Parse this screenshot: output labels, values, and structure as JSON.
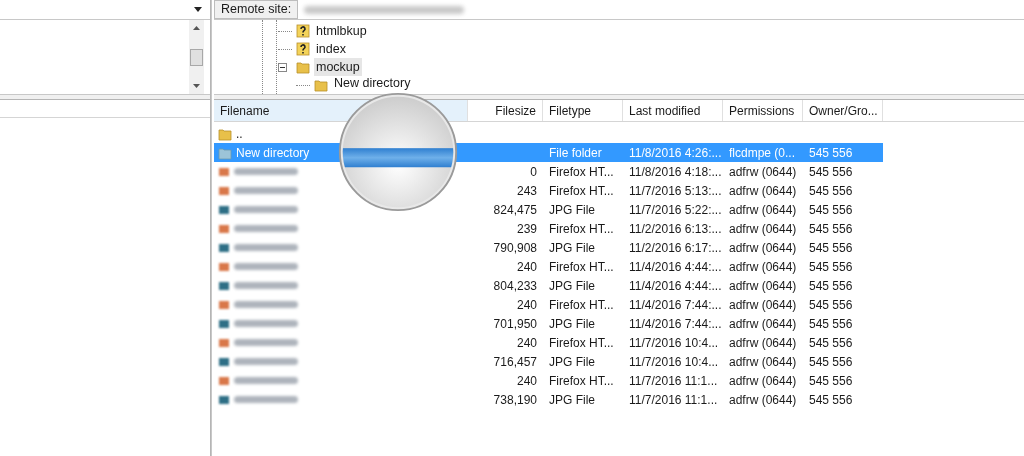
{
  "remote_site": {
    "label": "Remote site:"
  },
  "tree": [
    {
      "label": "htmlbkup",
      "kind": "unknown",
      "selected": false
    },
    {
      "label": "index",
      "kind": "unknown",
      "selected": false
    },
    {
      "label": "mockup",
      "kind": "folder",
      "selected": true,
      "expanded": true,
      "children": [
        {
          "label": "New directory",
          "kind": "folder",
          "selected": false
        }
      ]
    }
  ],
  "file_list": {
    "columns": [
      "Filename",
      "Filesize",
      "Filetype",
      "Last modified",
      "Permissions",
      "Owner/Gro..."
    ],
    "rows": [
      {
        "kind": "parent",
        "name": "..",
        "selected": false
      },
      {
        "kind": "folder",
        "name": "New directory",
        "filesize": "",
        "filetype": "File folder",
        "modified": "11/8/2016 4:26:...",
        "permissions": "flcdmpe (0...",
        "owner": "545 556",
        "selected": true
      },
      {
        "kind": "html",
        "filesize": "0",
        "filetype": "Firefox HT...",
        "modified": "11/8/2016 4:18:...",
        "permissions": "adfrw (0644)",
        "owner": "545 556",
        "selected": false
      },
      {
        "kind": "html",
        "filesize": "243",
        "filetype": "Firefox HT...",
        "modified": "11/7/2016 5:13:...",
        "permissions": "adfrw (0644)",
        "owner": "545 556",
        "selected": false
      },
      {
        "kind": "jpg",
        "filesize": "824,475",
        "filetype": "JPG File",
        "modified": "11/7/2016 5:22:...",
        "permissions": "adfrw (0644)",
        "owner": "545 556",
        "selected": false
      },
      {
        "kind": "html",
        "filesize": "239",
        "filetype": "Firefox HT...",
        "modified": "11/2/2016 6:13:...",
        "permissions": "adfrw (0644)",
        "owner": "545 556",
        "selected": false
      },
      {
        "kind": "jpg",
        "filesize": "790,908",
        "filetype": "JPG File",
        "modified": "11/2/2016 6:17:...",
        "permissions": "adfrw (0644)",
        "owner": "545 556",
        "selected": false
      },
      {
        "kind": "html",
        "filesize": "240",
        "filetype": "Firefox HT...",
        "modified": "11/4/2016 4:44:...",
        "permissions": "adfrw (0644)",
        "owner": "545 556",
        "selected": false
      },
      {
        "kind": "jpg",
        "filesize": "804,233",
        "filetype": "JPG File",
        "modified": "11/4/2016 4:44:...",
        "permissions": "adfrw (0644)",
        "owner": "545 556",
        "selected": false
      },
      {
        "kind": "html",
        "filesize": "240",
        "filetype": "Firefox HT...",
        "modified": "11/4/2016 7:44:...",
        "permissions": "adfrw (0644)",
        "owner": "545 556",
        "selected": false
      },
      {
        "kind": "jpg",
        "filesize": "701,950",
        "filetype": "JPG File",
        "modified": "11/4/2016 7:44:...",
        "permissions": "adfrw (0644)",
        "owner": "545 556",
        "selected": false
      },
      {
        "kind": "html",
        "filesize": "240",
        "filetype": "Firefox HT...",
        "modified": "11/7/2016 10:4...",
        "permissions": "adfrw (0644)",
        "owner": "545 556",
        "selected": false
      },
      {
        "kind": "jpg",
        "filesize": "716,457",
        "filetype": "JPG File",
        "modified": "11/7/2016 10:4...",
        "permissions": "adfrw (0644)",
        "owner": "545 556",
        "selected": false
      },
      {
        "kind": "html",
        "filesize": "240",
        "filetype": "Firefox HT...",
        "modified": "11/7/2016 11:1...",
        "permissions": "adfrw (0644)",
        "owner": "545 556",
        "selected": false
      },
      {
        "kind": "jpg",
        "filesize": "738,190",
        "filetype": "JPG File",
        "modified": "11/7/2016 11:1...",
        "permissions": "adfrw (0644)",
        "owner": "545 556",
        "selected": false
      }
    ]
  }
}
